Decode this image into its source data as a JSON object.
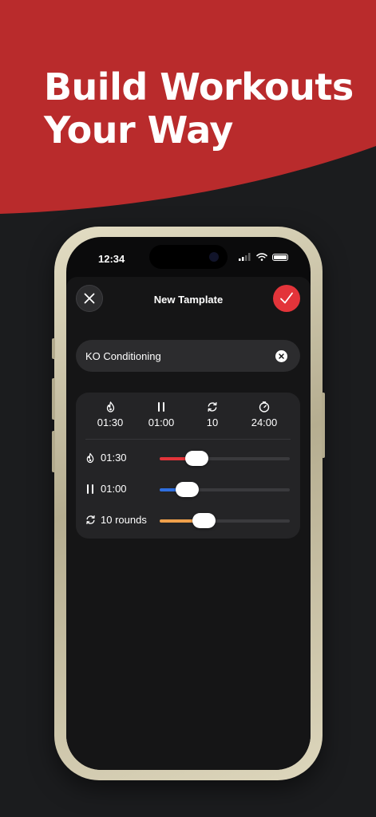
{
  "hero": {
    "line1": "Build Workouts",
    "line2": "Your Way",
    "background_color": "#b92b2c"
  },
  "status_bar": {
    "time": "12:34",
    "icons": [
      "signal-icon",
      "wifi-icon",
      "battery-icon"
    ]
  },
  "sheet": {
    "title": "New Tamplate",
    "close_icon": "close-icon",
    "confirm_icon": "checkmark-icon"
  },
  "name_field": {
    "value": "KO Conditioning",
    "clear_icon": "clear-x-icon"
  },
  "summary": [
    {
      "icon": "flame-icon",
      "value": "01:30"
    },
    {
      "icon": "pause-icon",
      "value": "01:00"
    },
    {
      "icon": "repeat-icon",
      "value": "10"
    },
    {
      "icon": "stopwatch-icon",
      "value": "24:00"
    }
  ],
  "sliders": [
    {
      "icon": "flame-icon",
      "label": "01:30",
      "color": "#e3343a",
      "level": 0.28
    },
    {
      "icon": "pause-icon",
      "label": "01:00",
      "color": "#2f6fe0",
      "level": 0.21
    },
    {
      "icon": "repeat-icon",
      "label": "10 rounds",
      "color": "#f0a04b",
      "level": 0.34
    }
  ],
  "colors": {
    "accent": "#e3343a",
    "background": "#1b1c1e",
    "card": "#242426"
  }
}
